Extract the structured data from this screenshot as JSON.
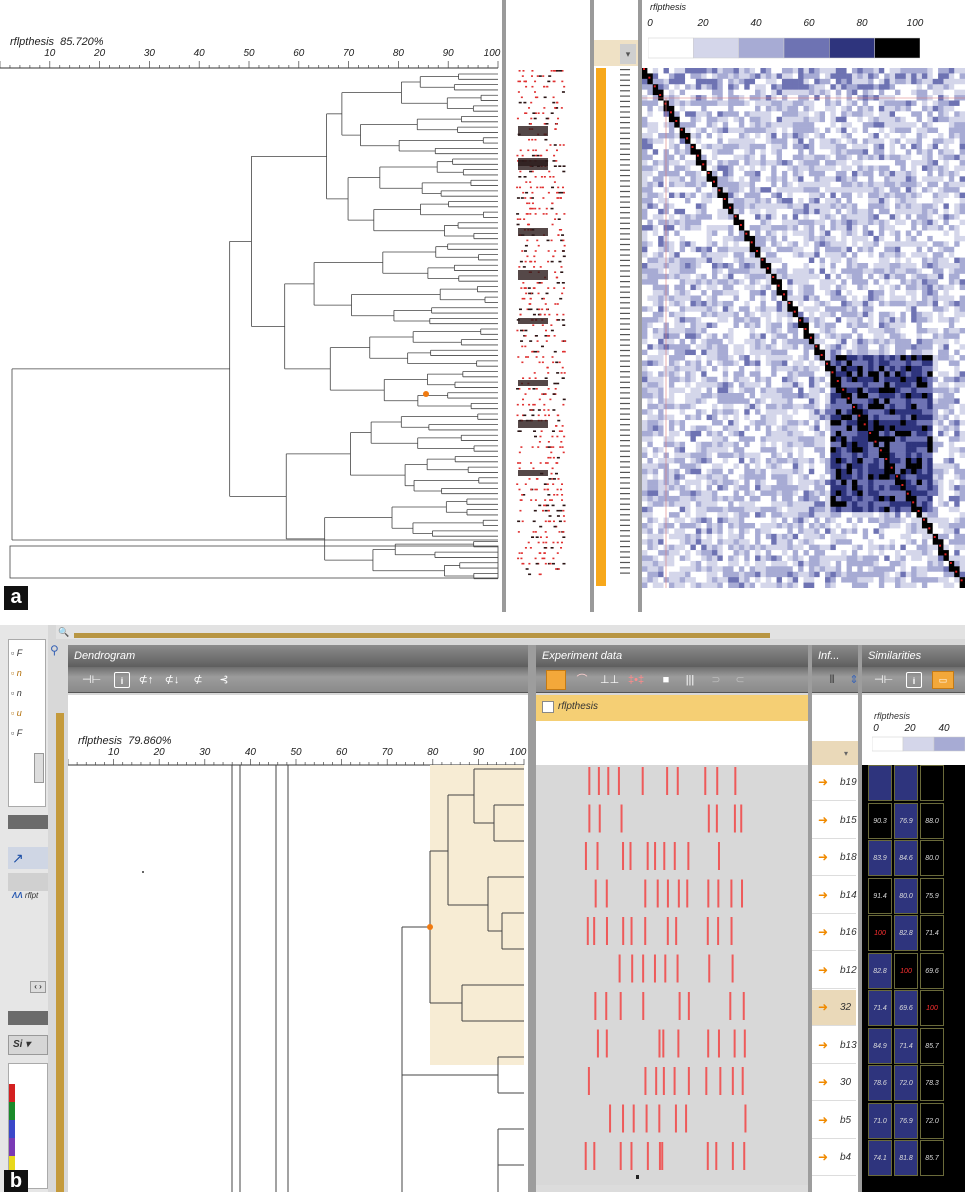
{
  "panel_a": {
    "label": "a",
    "ruler_title": "rflpthesis",
    "ruler_value": "85.720%",
    "ruler_ticks": [
      "10",
      "20",
      "30",
      "40",
      "50",
      "60",
      "70",
      "80",
      "90",
      "100"
    ],
    "legend_title": "rflpthesis",
    "legend_ticks": [
      "0",
      "20",
      "40",
      "60",
      "80",
      "100"
    ],
    "legend_colors": [
      "#ffffff",
      "#d4d6ea",
      "#a7abd4",
      "#6e73b3",
      "#2e347d",
      "#000000"
    ]
  },
  "panel_b": {
    "label": "b",
    "dendrogram": {
      "header": "Dendrogram",
      "ruler_title": "rflpthesis",
      "ruler_value": "79.860%",
      "ruler_ticks": [
        "10",
        "20",
        "30",
        "40",
        "50",
        "60",
        "70",
        "80",
        "90",
        "100"
      ]
    },
    "experiment": {
      "header": "Experiment data",
      "tab_label": "rflpthesis"
    },
    "info": {
      "header": "Inf...",
      "samples": [
        "b19",
        "b15",
        "b18",
        "b14",
        "b16",
        "b12",
        "32",
        "b13",
        "30",
        "b5",
        "b4"
      ]
    },
    "similarities": {
      "header": "Similarities",
      "legend_title": "rflpthesis",
      "legend_ticks": [
        "0",
        "20",
        "40"
      ],
      "rows": [
        [
          "",
          "",
          ""
        ],
        [
          "90.3",
          "76.9",
          "88.0"
        ],
        [
          "83.9",
          "84.6",
          "80.0"
        ],
        [
          "91.4",
          "80.0",
          "75.9"
        ],
        [
          "100",
          "82.8",
          "71.4"
        ],
        [
          "82.8",
          "100",
          "69.6"
        ],
        [
          "71.4",
          "69.6",
          "100"
        ],
        [
          "84.9",
          "71.4",
          "85.7"
        ],
        [
          "78.6",
          "72.0",
          "78.3"
        ],
        [
          "71.0",
          "76.9",
          "72.0"
        ],
        [
          "74.1",
          "81.8",
          "85.7"
        ]
      ]
    },
    "left_strip": {
      "items": [
        "F",
        "n",
        "n",
        "u",
        "F"
      ],
      "list_label": "rflpt",
      "dropdown_label": "Si"
    }
  }
}
